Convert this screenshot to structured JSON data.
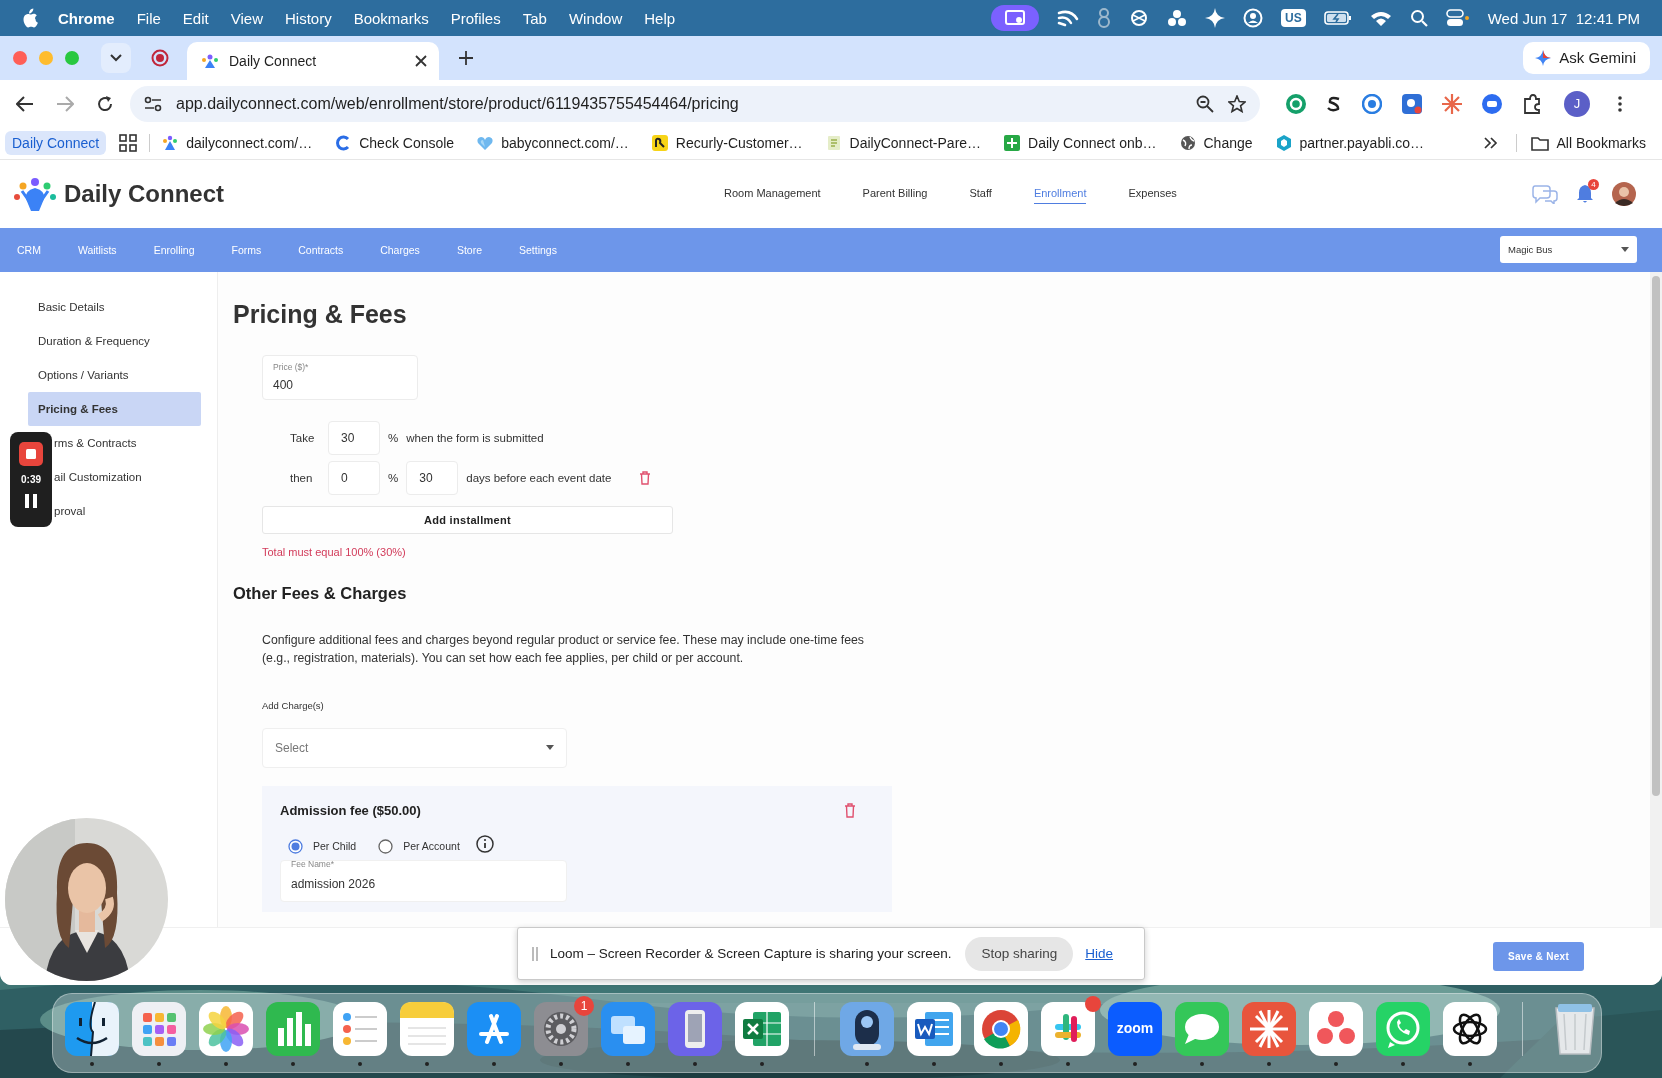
{
  "menu_bar": {
    "app": "Chrome",
    "items": [
      "File",
      "Edit",
      "View",
      "History",
      "Bookmarks",
      "Profiles",
      "Tab",
      "Window",
      "Help"
    ],
    "keyboard": "US",
    "clock": "Wed Jun 17  12:41 PM"
  },
  "browser": {
    "tab": {
      "title": "Daily Connect"
    },
    "ask_button": "Ask Gemini",
    "url": "app.dailyconnect.com/web/enrollment/store/product/6119435755454464/pricing",
    "profile_initial": "J",
    "tab_group": "Daily Connect",
    "bookmarks": [
      {
        "label": "dailyconnect.com/…",
        "kind": "people"
      },
      {
        "label": "Check Console",
        "kind": "c"
      },
      {
        "label": "babyconnect.com/…",
        "kind": "heart"
      },
      {
        "label": "Recurly-Customer…",
        "kind": "recurly"
      },
      {
        "label": "DailyConnect-Pare…",
        "kind": "page"
      },
      {
        "label": "Daily Connect onb…",
        "kind": "sheet"
      },
      {
        "label": "Change",
        "kind": "globe"
      },
      {
        "label": "partner.payabli.co…",
        "kind": "hex"
      }
    ],
    "all_bookmarks": "All Bookmarks"
  },
  "app": {
    "brand": "Daily Connect",
    "nav": [
      {
        "label": "Room Management",
        "selected": false
      },
      {
        "label": "Parent Billing",
        "selected": false
      },
      {
        "label": "Staff",
        "selected": false
      },
      {
        "label": "Enrollment",
        "selected": true
      },
      {
        "label": "Expenses",
        "selected": false
      }
    ],
    "notification_count": "4",
    "subnav": [
      "CRM",
      "Waitlists",
      "Enrolling",
      "Forms",
      "Contracts",
      "Charges",
      "Store",
      "Settings"
    ],
    "location": "Magic Bus"
  },
  "sidebar": [
    {
      "label": "Basic Details",
      "selected": false
    },
    {
      "label": "Duration & Frequency",
      "selected": false
    },
    {
      "label": "Options / Variants",
      "selected": false
    },
    {
      "label": "Pricing & Fees",
      "selected": true
    },
    {
      "label": "rms & Contracts",
      "selected": false
    },
    {
      "label": "ail Customization",
      "selected": false
    },
    {
      "label": "proval",
      "selected": false
    }
  ],
  "pricing": {
    "title": "Pricing & Fees",
    "price": {
      "label": "Price ($)*",
      "value": "400"
    },
    "installments": [
      {
        "prefix": "Take",
        "percent": "30",
        "percent_sign": "%",
        "suffix": "when the form is submitted",
        "deletable": false
      },
      {
        "prefix": "then",
        "percent": "0",
        "percent_sign": "%",
        "days": "30",
        "suffix": "days before each event date",
        "deletable": true
      }
    ],
    "add_button": "Add installment",
    "error": "Total must equal 100% (30%)"
  },
  "other_fees": {
    "title": "Other Fees & Charges",
    "description": "Configure additional fees and charges beyond regular product or service fee. These may include one-time fees (e.g., registration, materials). You can set how each fee applies, per child or per account.",
    "add_label": "Add Charge(s)",
    "select_placeholder": "Select",
    "fees": [
      {
        "title": "Admission fee ($50.00)",
        "options": [
          {
            "label": "Per Child",
            "selected": true
          },
          {
            "label": "Per Account",
            "selected": false
          }
        ],
        "name_label": "Fee Name*",
        "name_value": "admission 2026"
      }
    ]
  },
  "save_button": "Save & Next",
  "recorder": {
    "time": "0:39"
  },
  "loom_banner": {
    "message": "Loom – Screen Recorder & Screen Capture is sharing your screen.",
    "stop": "Stop sharing",
    "hide": "Hide"
  },
  "dock": [
    {
      "kind": "finder",
      "running": true
    },
    {
      "kind": "launchpad",
      "running": true
    },
    {
      "kind": "photos",
      "running": true
    },
    {
      "kind": "numbers",
      "running": true
    },
    {
      "kind": "reminders",
      "running": true
    },
    {
      "kind": "notes",
      "running": true
    },
    {
      "kind": "appstore",
      "running": true
    },
    {
      "kind": "settings",
      "running": true,
      "badge": "1"
    },
    {
      "kind": "mirror",
      "running": true
    },
    {
      "kind": "phone",
      "running": true
    },
    {
      "kind": "sheet",
      "running": true
    },
    {
      "kind": "separator"
    },
    {
      "kind": "camera",
      "running": true
    },
    {
      "kind": "doc",
      "running": true
    },
    {
      "kind": "browser",
      "running": true
    },
    {
      "kind": "slack",
      "running": true,
      "dot": true
    },
    {
      "kind": "zoom",
      "running": true,
      "label": "zoom"
    },
    {
      "kind": "messages",
      "running": true
    },
    {
      "kind": "burst",
      "running": true
    },
    {
      "kind": "trio",
      "running": true
    },
    {
      "kind": "whatsapp",
      "running": true
    },
    {
      "kind": "knot",
      "running": true
    },
    {
      "kind": "separator"
    },
    {
      "kind": "trash",
      "running": false
    }
  ]
}
